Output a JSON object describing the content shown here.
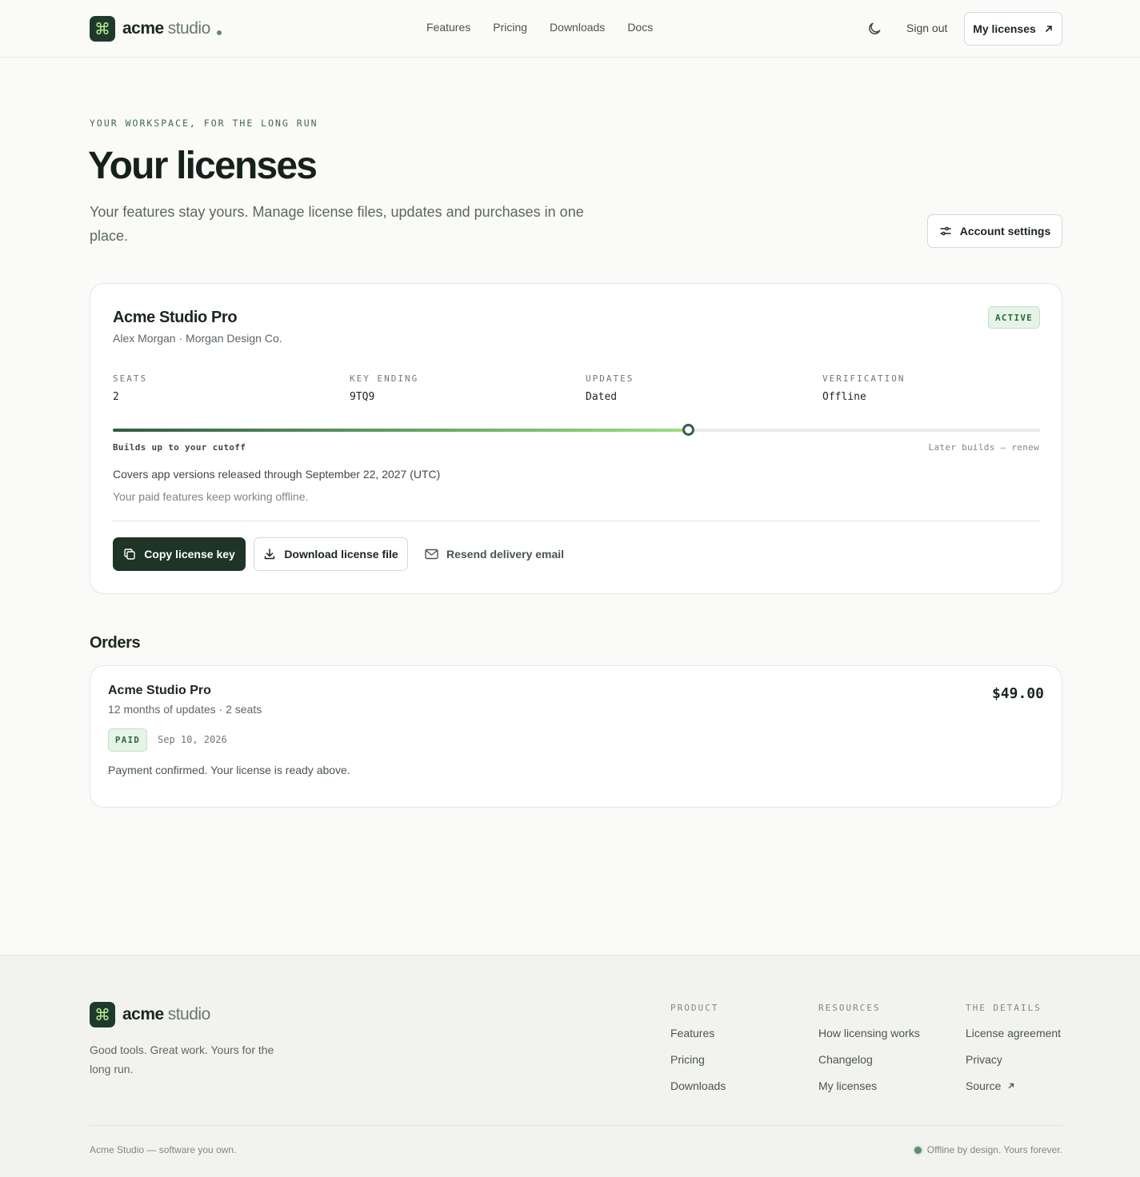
{
  "header": {
    "brand_bold": "acme",
    "brand_light": "studio",
    "nav": [
      "Features",
      "Pricing",
      "Downloads",
      "Docs"
    ],
    "sign_out": "Sign out",
    "my_licenses": "My licenses"
  },
  "hero": {
    "eyebrow": "YOUR WORKSPACE, FOR THE LONG RUN",
    "title": "Your licenses",
    "subtitle": "Your features stay yours. Manage license files, updates and purchases in one place.",
    "account_settings": "Account settings"
  },
  "license": {
    "name": "Acme Studio Pro",
    "owner": "Alex Morgan · Morgan Design Co.",
    "status": "ACTIVE",
    "stats": [
      {
        "label": "SEATS",
        "value": "2"
      },
      {
        "label": "KEY ENDING",
        "value": "9TQ9"
      },
      {
        "label": "UPDATES",
        "value": "Dated"
      },
      {
        "label": "VERIFICATION",
        "value": "Offline"
      }
    ],
    "progress_fraction": 0.62,
    "caption_left": "Builds up to your cutoff",
    "caption_right": "Later builds — renew",
    "covers": "Covers app versions released through September 22, 2027 (UTC)",
    "offline_note": "Your paid features keep working offline.",
    "copy_label": "Copy license key",
    "download_label": "Download license file",
    "resend_label": "Resend delivery email"
  },
  "orders": {
    "title": "Orders",
    "items": [
      {
        "name": "Acme Studio Pro",
        "meta": "12 months of updates · 2 seats",
        "price": "$49.00",
        "status": "PAID",
        "date": "Sep 10, 2026",
        "note": "Payment confirmed. Your license is ready above."
      }
    ]
  },
  "footer": {
    "tagline": "Good tools. Great work. Yours for the long run.",
    "columns": [
      {
        "title": "PRODUCT",
        "links": [
          "Features",
          "Pricing",
          "Downloads"
        ]
      },
      {
        "title": "RESOURCES",
        "links": [
          "How licensing works",
          "Changelog",
          "My licenses"
        ]
      },
      {
        "title": "THE DETAILS",
        "links": [
          "License agreement",
          "Privacy",
          "Source"
        ]
      }
    ],
    "copyright": "Acme Studio — software you own.",
    "status": "Offline by design. Yours forever."
  },
  "colors": {
    "brand_dark": "#1f3a2c",
    "accent_light": "#b7f08d",
    "badge_bg": "#e6f4e7",
    "badge_text": "#2d6a41"
  },
  "icons": [
    "command-icon",
    "moon-icon",
    "arrow-up-right-icon",
    "sliders-icon",
    "copy-icon",
    "download-icon",
    "mail-icon"
  ]
}
